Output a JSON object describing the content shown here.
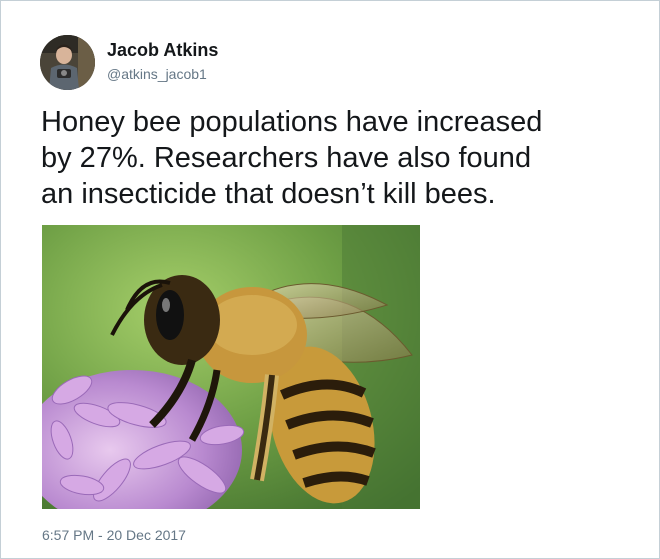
{
  "author": {
    "display_name": "Jacob Atkins",
    "handle": "@atkins_jacob1"
  },
  "tweet": {
    "lines": [
      "Honey bee populations have increased",
      "by 27%. Researchers have also found",
      "an insecticide that doesn’t kill bees."
    ],
    "timestamp": "6:57 PM - 20 Dec 2017"
  },
  "colors": {
    "name_text": "#14171a",
    "meta_text": "#657786",
    "card_border": "#c4cfd6"
  },
  "icons": {
    "avatar": "avatar-photo",
    "photo": "honey-bee-on-purple-flower-photo"
  }
}
